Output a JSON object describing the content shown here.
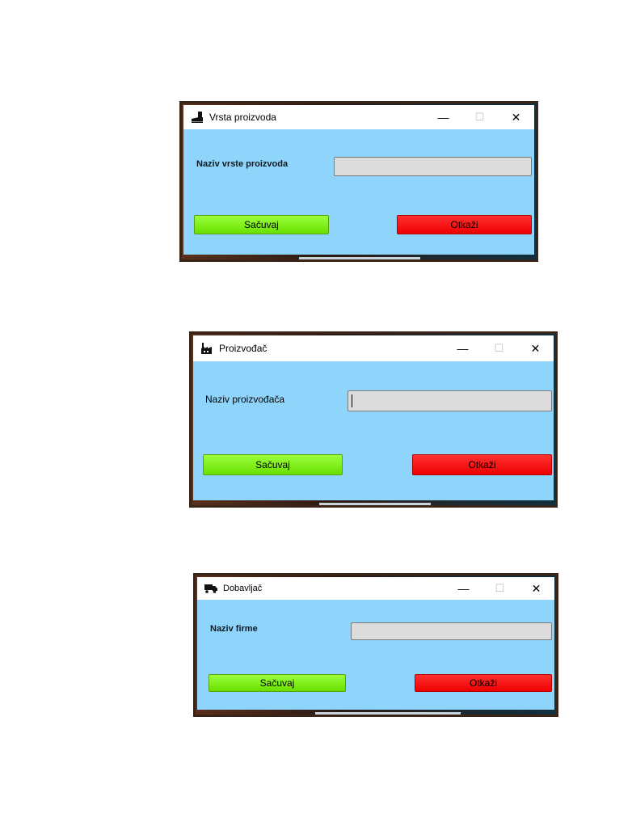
{
  "dialogs": [
    {
      "title": "Vrsta proizvoda",
      "icon": "shoe-icon",
      "field_label": "Naziv vrste proizvoda",
      "field_value": "",
      "save_label": "Sačuvaj",
      "cancel_label": "Otkaži"
    },
    {
      "title": "Proizvođač",
      "icon": "factory-icon",
      "field_label": "Naziv proizvođača",
      "field_value": "",
      "save_label": "Sačuvaj",
      "cancel_label": "Otkaži"
    },
    {
      "title": "Dobavljač",
      "icon": "truck-icon",
      "field_label": "Naziv firme",
      "field_value": "",
      "save_label": "Sačuvaj",
      "cancel_label": "Otkaži"
    }
  ],
  "window_controls": {
    "minimize": "—",
    "maximize": "☐",
    "close": "✕"
  },
  "colors": {
    "dialog_bg": "#8ed4fb",
    "save_button": "#7cf000",
    "cancel_button": "#ff0000",
    "input_bg": "#dcdcdc"
  }
}
